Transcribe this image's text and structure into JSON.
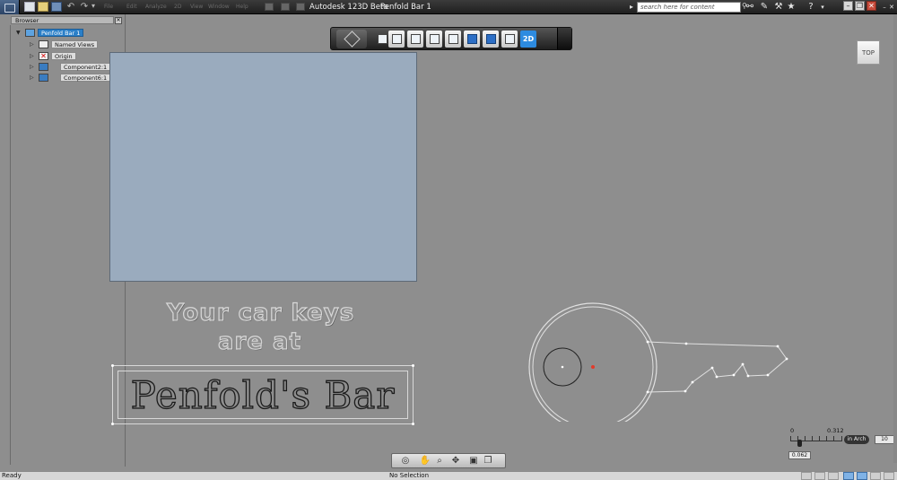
{
  "window": {
    "app_title": "Autodesk 123D Beta",
    "document_title": "Penfold Bar 1",
    "search_placeholder": "search here for content"
  },
  "menu": [
    "File",
    "Edit",
    "Analyze",
    "2D",
    "View",
    "Window",
    "Help"
  ],
  "browser": {
    "header": "Browser",
    "items": [
      {
        "label": "Penfold Bar 1",
        "expander": "▼",
        "selected": true
      },
      {
        "label": "Named Views",
        "expander": "▷",
        "selected": false
      },
      {
        "label": "Origin",
        "expander": "▷",
        "selected": false
      },
      {
        "label": "Component2:1",
        "expander": "▷",
        "selected": false
      },
      {
        "label": "Component6:1",
        "expander": "▷",
        "selected": false
      }
    ]
  },
  "navbar": {
    "buttons": [
      "viewcube-home",
      "info",
      "box",
      "move",
      "rotate",
      "box-view",
      "front-view",
      "grid-view",
      "materials",
      "2d-sketch"
    ],
    "twod_label": "2D"
  },
  "viewcube": {
    "face": "TOP"
  },
  "canvas": {
    "headline_line1": "Your car keys",
    "headline_line2": "are at",
    "plaque_text": "Penfold's Bar"
  },
  "scale": {
    "left_tick": "0",
    "right_tick": "0.312",
    "value": "0.062",
    "unit": "in Arch",
    "grid_count": "10"
  },
  "status": {
    "left": "Ready",
    "center": "No Selection"
  },
  "colors": {
    "viewport_bg": "#8e8e8e",
    "photo_fill": "#9aabbe",
    "selection_blue": "#2a7fc8",
    "sketch_line": "#e0e0e0"
  }
}
